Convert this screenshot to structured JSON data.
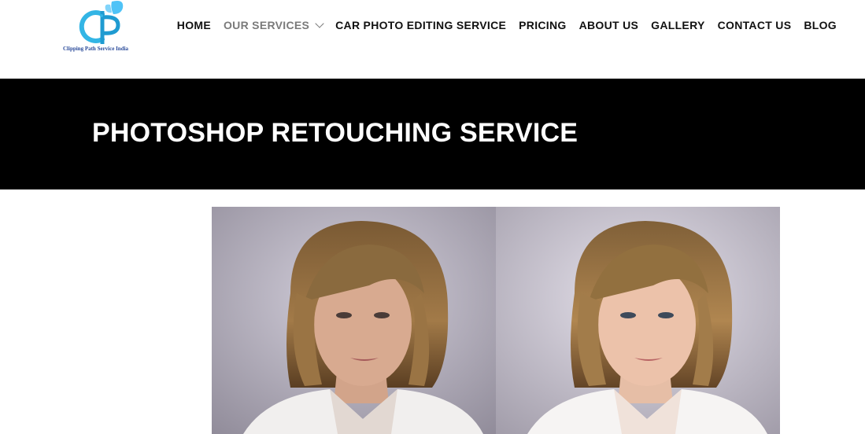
{
  "logo": {
    "icon": "cp-butterfly-logo",
    "text": "Clipping Path Service India",
    "colors": {
      "primary": "#33b5e5",
      "text": "#2a4a9a"
    }
  },
  "nav": {
    "items": [
      {
        "label": "HOME",
        "active": false
      },
      {
        "label": "OUR SERVICES",
        "active": true,
        "has_dropdown": true
      },
      {
        "label": "CAR PHOTO EDITING SERVICE",
        "active": false
      },
      {
        "label": "PRICING",
        "active": false
      },
      {
        "label": "ABOUT US",
        "active": false
      },
      {
        "label": "GALLERY",
        "active": false
      },
      {
        "label": "CONTACT US",
        "active": false
      },
      {
        "label": "BLOG",
        "active": false
      }
    ]
  },
  "banner": {
    "title": "PHOTOSHOP RETOUCHING SERVICE",
    "background": "#000000",
    "color": "#ffffff"
  },
  "comparison": {
    "before": {
      "icon": "portrait-photo-before"
    },
    "after": {
      "icon": "portrait-photo-after"
    }
  }
}
